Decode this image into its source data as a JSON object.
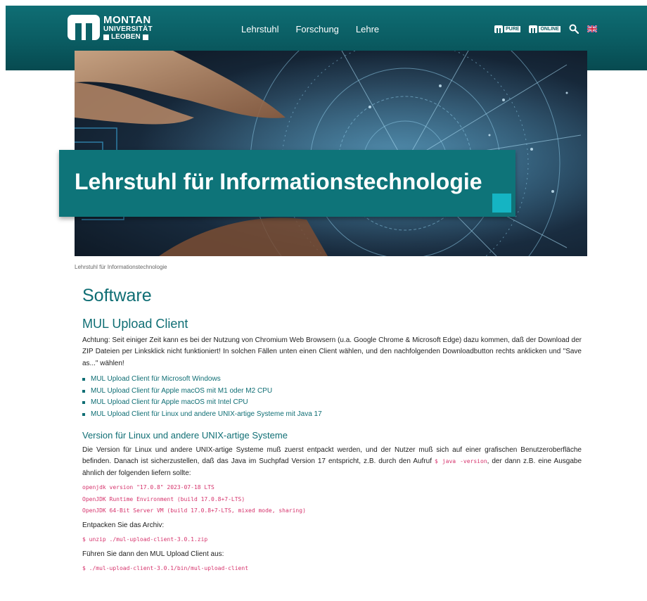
{
  "header": {
    "logo": {
      "line1": "MONTAN",
      "line2": "UNIVERSITÄT",
      "line3": "LEOBEN"
    },
    "nav": [
      "Lehrstuhl",
      "Forschung",
      "Lehre"
    ],
    "tools": {
      "pure_label": "PURE",
      "online_label": "ONLINE",
      "search_icon": "search-icon",
      "language_icon": "uk-flag-icon"
    }
  },
  "hero": {
    "title": "Lehrstuhl für Informationstechnologie"
  },
  "breadcrumb": "Lehrstuhl für Informationstechnologie",
  "page": {
    "title": "Software",
    "section1": {
      "heading": "MUL Upload Client",
      "text": "Achtung: Seit einiger Zeit kann es bei der Nutzung von Chromium Web Browsern (u.a. Google Chrome & Microsoft Edge) dazu kommen, daß der Download der ZIP Dateien per Linksklick nicht funktioniert! In solchen Fällen unten einen Client wählen, und den nachfolgenden Downloadbutton rechts anklicken und \"Save as...\" wählen!",
      "links": [
        "MUL Upload Client für Microsoft Windows",
        "MUL Upload Client für Apple macOS mit M1 oder M2 CPU",
        "MUL Upload Client für Apple macOS mit Intel CPU",
        "MUL Upload Client für Linux und andere UNIX-artige Systeme mit Java 17"
      ]
    },
    "section2": {
      "heading": "Version für Linux und andere UNIX-artige Systeme",
      "text_part1": "Die Version für Linux und andere UNIX-artige Systeme muß zuerst entpackt werden, und der Nutzer muß sich auf einer grafischen Benutzeroberfläche befinden. Danach ist sicherzustellen, daß das Java im Suchpfad Version 17 entspricht, z.B. durch den Aufruf",
      "inline_code": "$ java -version",
      "text_part2": ", der dann z.B. eine Ausgabe ähnlich der folgenden liefern sollte:",
      "java_output": [
        "openjdk version \"17.0.8\" 2023-07-18 LTS",
        "OpenJDK Runtime Environment (build 17.0.8+7-LTS)",
        "OpenJDK 64-Bit Server VM (build 17.0.8+7-LTS, mixed mode, sharing)"
      ],
      "unpack_text": "Entpacken Sie das Archiv:",
      "unpack_cmd": "$ unzip ./mul-upload-client-3.0.1.zip",
      "run_text": "Führen Sie dann den MUL Upload Client aus:",
      "run_cmd": "$ ./mul-upload-client-3.0.1/bin/mul-upload-client"
    }
  },
  "colors": {
    "brand": "#0f6e74",
    "accent": "#15b4c3",
    "code": "#d6336c"
  }
}
